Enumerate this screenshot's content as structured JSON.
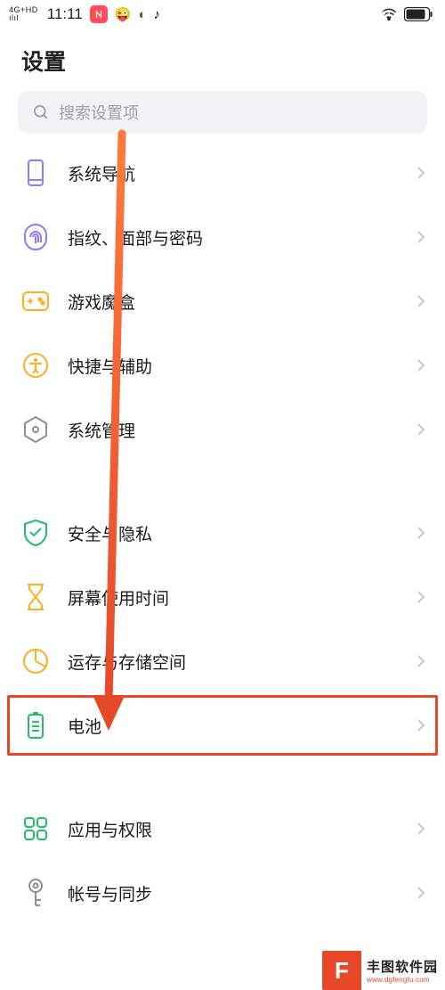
{
  "status": {
    "network_top": "4G+HD",
    "network_bot": "ılıl",
    "time": "11:11",
    "battery_pct": "84"
  },
  "title": "设置",
  "search": {
    "placeholder": "搜索设置项"
  },
  "group1": [
    {
      "key": "sysnav",
      "icon": "phone-icon",
      "label": "系统导航"
    },
    {
      "key": "biometric",
      "icon": "fingerprint-icon",
      "label": "指纹、面部与密码"
    },
    {
      "key": "gamebox",
      "icon": "gamepad-icon",
      "label": "游戏魔盒"
    },
    {
      "key": "shortcut",
      "icon": "accessibility-icon",
      "label": "快捷与辅助"
    },
    {
      "key": "sysmgr",
      "icon": "hex-gear-icon",
      "label": "系统管理"
    }
  ],
  "group2": [
    {
      "key": "privacy",
      "icon": "shield-check-icon",
      "label": "安全与隐私"
    },
    {
      "key": "screentime",
      "icon": "hourglass-icon",
      "label": "屏幕使用时间"
    },
    {
      "key": "storage",
      "icon": "pie-icon",
      "label": "运存与存储空间"
    },
    {
      "key": "battery",
      "icon": "battery-icon",
      "label": "电池"
    }
  ],
  "group3": [
    {
      "key": "apps",
      "icon": "grid-icon",
      "label": "应用与权限"
    },
    {
      "key": "account",
      "icon": "key-icon",
      "label": "帐号与同步"
    }
  ],
  "watermark": {
    "logo": "F",
    "name": "丰图软件园",
    "url": "www.dgfengtu.com"
  },
  "colors": {
    "violet": "#8f7bff",
    "orange": "#ffb020",
    "gray": "#8a8f98",
    "green": "#1fbf6b",
    "highlight": "#e7482a"
  }
}
